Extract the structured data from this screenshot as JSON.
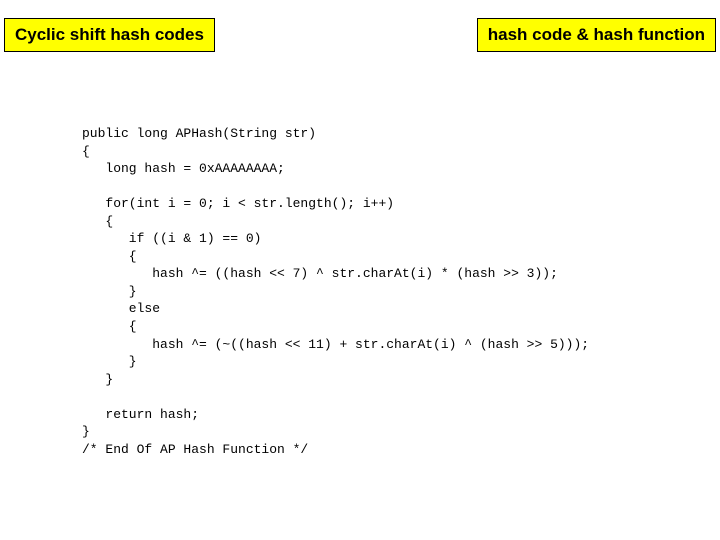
{
  "title": "Cyclic shift hash codes",
  "tag": "hash code & hash function",
  "code": "public long APHash(String str)\n{\n   long hash = 0xAAAAAAAA;\n\n   for(int i = 0; i < str.length(); i++)\n   {\n      if ((i & 1) == 0)\n      {\n         hash ^= ((hash << 7) ^ str.charAt(i) * (hash >> 3));\n      }\n      else\n      {\n         hash ^= (~((hash << 11) + str.charAt(i) ^ (hash >> 5)));\n      }\n   }\n\n   return hash;\n}\n/* End Of AP Hash Function */"
}
